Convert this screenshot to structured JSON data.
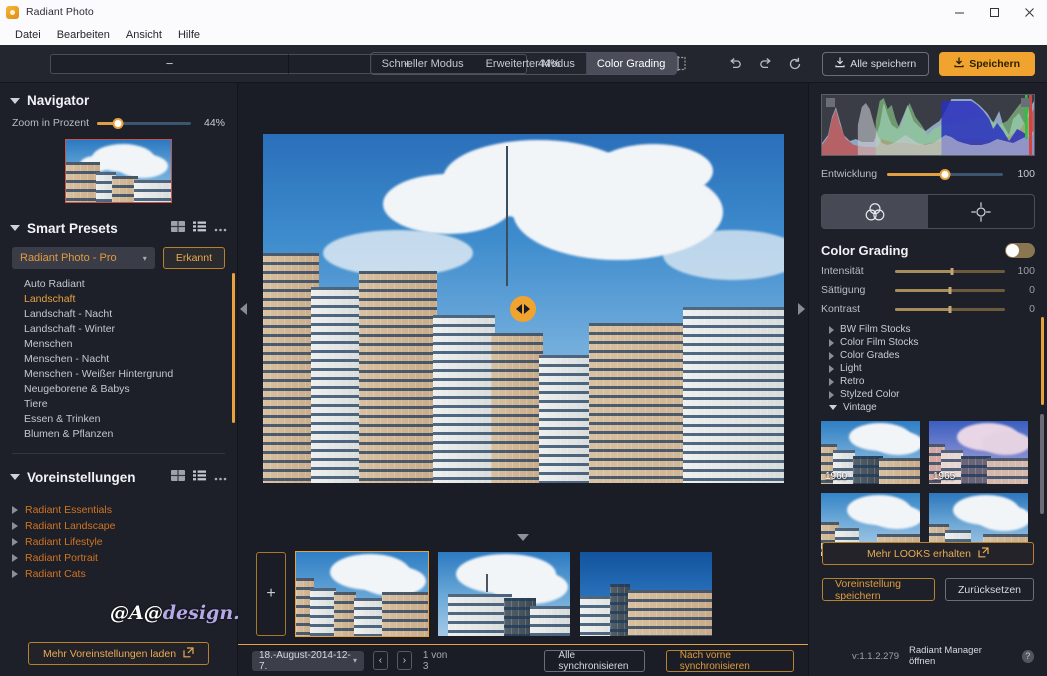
{
  "window": {
    "title": "Radiant Photo",
    "logo_icon": "radiant-logo-icon",
    "minimize_icon": "minimize-icon",
    "maximize_icon": "maximize-icon",
    "close_icon": "close-icon"
  },
  "menu": {
    "items": [
      {
        "label": "Datei"
      },
      {
        "label": "Bearbeiten"
      },
      {
        "label": "Ansicht"
      },
      {
        "label": "Hilfe"
      }
    ]
  },
  "toolbar": {
    "zoom_out_label": "−",
    "zoom_in_label": "+",
    "zoom_percent": "44%",
    "view_modes": [
      {
        "name": "view-single-icon",
        "active": true
      },
      {
        "name": "view-split-icon",
        "active": false
      },
      {
        "name": "view-compare-icon",
        "active": false
      }
    ],
    "mode_tabs": [
      {
        "label": "Schneller Modus",
        "active": false
      },
      {
        "label": "Erweiterter Modus",
        "active": false
      },
      {
        "label": "Color Grading",
        "active": true
      }
    ],
    "undo_icon": "undo-icon",
    "redo_icon": "redo-icon",
    "reset_icon": "reset-icon",
    "save_all_label": "Alle speichern",
    "save_label": "Speichern",
    "download_icon": "download-icon"
  },
  "navigator": {
    "title": "Navigator",
    "zoom_label": "Zoom in Prozent",
    "zoom_value": "44%",
    "zoom_fill_percent": 22
  },
  "smart_presets": {
    "title": "Smart Presets",
    "grid_icon": "grid-view-icon",
    "list_icon": "list-view-icon",
    "more_icon": "more-options-icon",
    "profile_select": "Radiant Photo - Pro",
    "detected_label": "Erkannt",
    "items": [
      {
        "label": "Auto Radiant",
        "selected": false
      },
      {
        "label": "Landschaft",
        "selected": true
      },
      {
        "label": "Landschaft - Nacht",
        "selected": false
      },
      {
        "label": "Landschaft - Winter",
        "selected": false
      },
      {
        "label": "Menschen",
        "selected": false
      },
      {
        "label": "Menschen - Nacht",
        "selected": false
      },
      {
        "label": "Menschen - Weißer Hintergrund",
        "selected": false
      },
      {
        "label": "Neugeborene & Babys",
        "selected": false
      },
      {
        "label": "Tiere",
        "selected": false
      },
      {
        "label": "Essen & Trinken",
        "selected": false
      },
      {
        "label": "Blumen & Pflanzen",
        "selected": false
      }
    ]
  },
  "presets": {
    "title": "Voreinstellungen",
    "grid_icon": "grid-view-icon",
    "list_icon": "list-view-icon",
    "more_icon": "more-options-icon",
    "groups": [
      {
        "label": "Radiant Essentials"
      },
      {
        "label": "Radiant Landscape"
      },
      {
        "label": "Radiant Lifestyle"
      },
      {
        "label": "Radiant Portrait"
      },
      {
        "label": "Radiant Cats"
      }
    ],
    "load_more_label": "Mehr Voreinstellungen laden",
    "external_icon": "external-link-icon"
  },
  "watermark": {
    "prefix": "@A@",
    "suffix": "design.eu"
  },
  "canvas": {
    "collapse_left_icon": "collapse-left-icon",
    "collapse_right_icon": "collapse-right-icon",
    "split_handle_icon": "before-after-split-handle-icon"
  },
  "filmstrip": {
    "collapse_icon": "filmstrip-collapse-icon",
    "add_label": "+",
    "thumbs": [
      {
        "name": "filmstrip-thumb-1",
        "selected": true
      },
      {
        "name": "filmstrip-thumb-2",
        "selected": false
      },
      {
        "name": "filmstrip-thumb-3",
        "selected": false
      }
    ],
    "folder_select": "18.-August-2014-12-7.",
    "prev_icon": "chevron-left-icon",
    "next_icon": "chevron-right-icon",
    "page_label": "1 von 3",
    "sync_all_label": "Alle synchronisieren",
    "sync_forward_label": "Nach vorne synchronisieren"
  },
  "right_panel": {
    "histogram_icon": "histogram-display",
    "development_label": "Entwicklung",
    "development_value": "100",
    "development_fill_percent": 50,
    "tool_tabs": [
      {
        "name": "color-wheels-icon",
        "active": true
      },
      {
        "name": "target-adjust-icon",
        "active": false
      }
    ],
    "color_grading": {
      "title": "Color Grading",
      "toggle_on": false,
      "sliders": [
        {
          "label": "Intensität",
          "value": "100",
          "fill_percent": 52
        },
        {
          "label": "Sättigung",
          "value": "0",
          "fill_percent": 50
        },
        {
          "label": "Kontrast",
          "value": "0",
          "fill_percent": 50
        }
      ]
    },
    "looks_tree": [
      {
        "label": "BW Film Stocks",
        "expanded": false
      },
      {
        "label": "Color Film Stocks",
        "expanded": false
      },
      {
        "label": "Color Grades",
        "expanded": false
      },
      {
        "label": "Light",
        "expanded": false
      },
      {
        "label": "Retro",
        "expanded": false
      },
      {
        "label": "Stylzed Color",
        "expanded": false
      },
      {
        "label": "Vintage",
        "expanded": true
      }
    ],
    "look_tiles": [
      {
        "caption": "1960"
      },
      {
        "caption": "1965"
      },
      {
        "caption": ""
      },
      {
        "caption": ""
      }
    ],
    "more_looks_label": "Mehr LOOKS erhalten",
    "external_icon": "external-link-icon",
    "save_preset_label": "Voreinstellung speichern",
    "reset_label": "Zurücksetzen",
    "version": "v:1.1.2.279",
    "manager_label": "Radiant Manager öffnen",
    "help_icon": "help-icon",
    "help_glyph": "?"
  },
  "colors": {
    "accent": "#e8a23d",
    "accent_button": "#f0a32e",
    "panel_bg": "#1e2029",
    "canvas_bg": "#1b1d26",
    "titlebar_bg": "#fbfbfd",
    "preset_group": "#d1741f"
  }
}
